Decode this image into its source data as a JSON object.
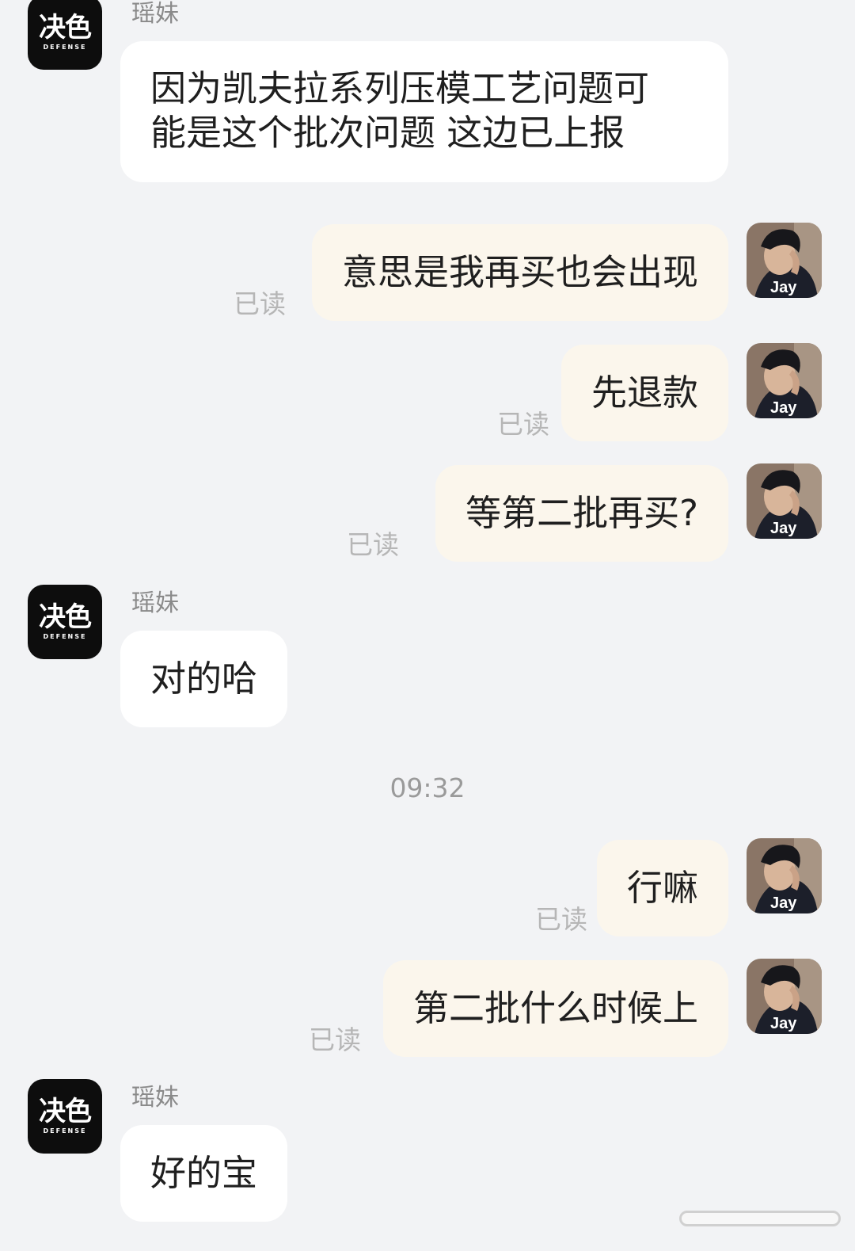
{
  "brand": {
    "name_cn": "决色",
    "name_en": "DEFENSE"
  },
  "peer_avatar": {
    "label": "Jay"
  },
  "messages": [
    {
      "sender": "瑶妹",
      "text": "因为凯夫拉系列压模工艺问题可\n能是这个批次问题 这边已上报"
    },
    {
      "text": "意思是我再买也会出现",
      "status": "已读"
    },
    {
      "text": "先退款",
      "status": "已读"
    },
    {
      "text": "等第二批再买?",
      "status": "已读"
    },
    {
      "sender": "瑶妹",
      "text": "对的哈"
    },
    {
      "time": "09:32"
    },
    {
      "text": "行嘛",
      "status": "已读"
    },
    {
      "text": "第二批什么时候上",
      "status": "已读"
    },
    {
      "sender": "瑶妹",
      "text": "好的宝"
    }
  ],
  "colors": {
    "background": "#f2f3f5",
    "incoming_bubble": "#ffffff",
    "outgoing_bubble": "#fbf6ec",
    "brand_avatar": "#0d0d0d"
  }
}
